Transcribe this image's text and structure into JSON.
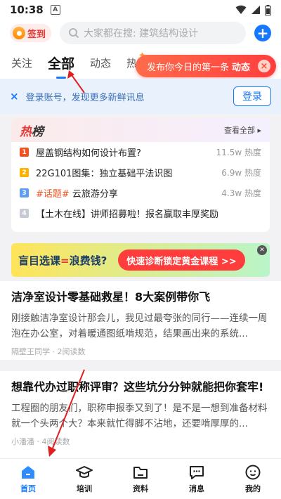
{
  "status": {
    "time": "10:38",
    "badge": "A"
  },
  "header": {
    "signin_label": "签到",
    "search_placeholder": "大家都在搜: 建筑结构设计"
  },
  "tabs": [
    {
      "label": "关注"
    },
    {
      "label": "全部"
    },
    {
      "label": "动态"
    },
    {
      "label": "热"
    }
  ],
  "publish_tip": {
    "text": "发布你今日的第一条",
    "highlight": "动态"
  },
  "login_bar": {
    "text": "登录账号，发现更多新鲜讯息",
    "button": "登录"
  },
  "hot": {
    "title_a": "热",
    "title_b": "榜",
    "view_all": "查看全部 ▸",
    "items": [
      {
        "rank": "1",
        "color": "#f4511e",
        "tag": "",
        "text": "屋盖钢结构如何设计布置?",
        "heat": "11.5w 热度"
      },
      {
        "rank": "2",
        "color": "#ffb300",
        "tag": "",
        "text": "22G101图集：独立基础平法识图",
        "heat": "6.9w 热度"
      },
      {
        "rank": "3",
        "color": "#5c9df5",
        "tag": "#话题#",
        "text": " 云旅游分享",
        "heat": "4.3w 热度"
      },
      {
        "rank": "4",
        "color": "#c5cad3",
        "tag": "",
        "text": "【土木在线】讲师招募啦！报名赢取丰厚奖励",
        "heat": ""
      }
    ]
  },
  "banner": {
    "left_a": "盲目选课",
    "left_eq": "=",
    "left_b": "浪费钱?",
    "right": "快速诊断锁定黄金课程 >>"
  },
  "articles": [
    {
      "title": "洁净室设计零基础救星！8大案例带你飞",
      "body": "刚接触洁净室设计那会儿，我见过最夸张的同行——连续一周泡在办公室，对着暖通图纸啃规范，结果画出来的系统...",
      "meta": "隔壁王同学 · 2阅读数"
    },
    {
      "title": "想靠代办过职称评审？这些坑分分钟就能把你套牢!",
      "body": "工程圈的朋友们，职称申报季又到了！是不是一想到准备材料就一个头两个大？本来就忙得脚不沾地，还要啃厚厚的...",
      "meta": "小潘潘 · 4阅读数"
    }
  ],
  "nav": [
    {
      "label": "首页",
      "icon": "home-icon"
    },
    {
      "label": "培训",
      "icon": "graduation-cap-icon"
    },
    {
      "label": "资料",
      "icon": "folder-icon"
    },
    {
      "label": "消息",
      "icon": "message-icon"
    },
    {
      "label": "我的",
      "icon": "profile-icon"
    }
  ],
  "colors": {
    "accent": "#1677ff",
    "hot": "#e53935",
    "annotation_arrow": "#e02020"
  }
}
